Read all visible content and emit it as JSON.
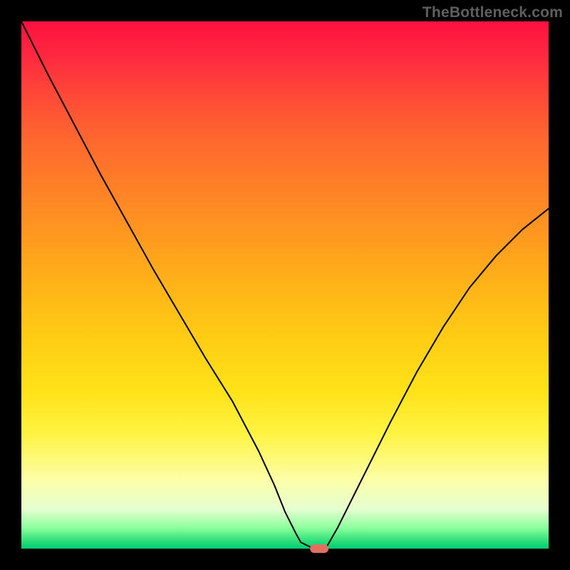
{
  "watermark": "TheBottleneck.com",
  "chart_data": {
    "type": "line",
    "title": "",
    "xlabel": "",
    "ylabel": "",
    "xlim": [
      0,
      100
    ],
    "ylim": [
      0,
      100
    ],
    "grid": false,
    "series": [
      {
        "name": "bottleneck-curve",
        "x": [
          0,
          5,
          10,
          15,
          20,
          25,
          30,
          35,
          40,
          45,
          48,
          50,
          52,
          53,
          55,
          56,
          57,
          58,
          60,
          65,
          70,
          75,
          80,
          85,
          90,
          95,
          100
        ],
        "y": [
          100,
          90,
          80.5,
          71,
          62,
          53,
          44.5,
          36,
          28,
          18.5,
          12,
          7,
          3,
          1.2,
          0.2,
          0,
          0,
          0.5,
          4,
          14,
          24,
          33.5,
          42,
          49.5,
          55.5,
          60.5,
          64.5
        ]
      }
    ],
    "annotations": [
      {
        "name": "minimum-marker",
        "x": 56.5,
        "y": 0,
        "shape": "pill",
        "color": "#e27060"
      }
    ],
    "legend": false
  }
}
